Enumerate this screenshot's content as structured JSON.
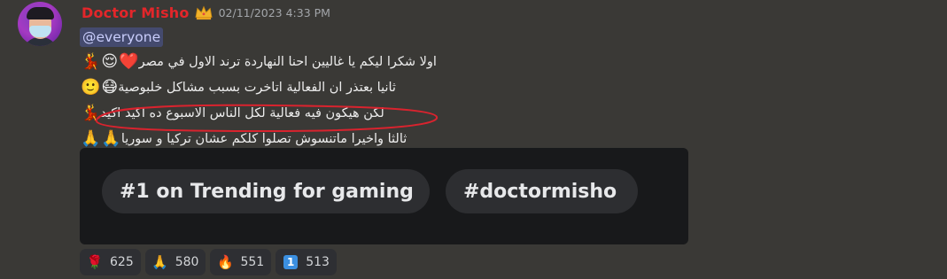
{
  "author": {
    "name": "Doctor Misho",
    "name_color": "#e3262a",
    "badge_icon": "crown-icon",
    "avatar_icon": "avatar-masked-man-icon"
  },
  "timestamp": "02/11/2023 4:33 PM",
  "mention": "@everyone",
  "lines": [
    {
      "text": "اولا شكرا ليكم يا غاليين احنا النهاردة ترند الاول في مصر",
      "emojis": [
        "❤️",
        "😌",
        "💃"
      ]
    },
    {
      "text": "ثانيا بعتذر ان الفعالية اتاخرت بسبب مشاكل خلبوصية",
      "emojis": [
        "😷",
        "🙂"
      ]
    },
    {
      "text": "لكن هيكون فيه فعالية لكل الناس الاسبوع ده اكيد اكيد",
      "emojis": [
        "💃"
      ]
    },
    {
      "text": "ثالثا واخيرا ماتنسوش تصلوا كلكم عشان تركيا و سوريا",
      "emojis": [
        "🙏",
        "🙏"
      ]
    }
  ],
  "embed": {
    "tags": [
      "#1 on Trending for gaming",
      "#doctormisho"
    ]
  },
  "reactions": [
    {
      "icon": "rose-icon",
      "glyph": "🌹",
      "count": "625"
    },
    {
      "icon": "folded-hands-icon",
      "glyph": "🙏",
      "count": "580"
    },
    {
      "icon": "fire-icon",
      "glyph": "🔥",
      "count": "551"
    },
    {
      "icon": "keycap-one-icon",
      "glyph": "1",
      "count": "513"
    }
  ],
  "colors": {
    "background": "#3a3936",
    "embed_bg": "#18191b",
    "pill_bg": "#2d2e31",
    "mention_bg": "#444a6e",
    "highlight_circle": "#d9232e"
  }
}
